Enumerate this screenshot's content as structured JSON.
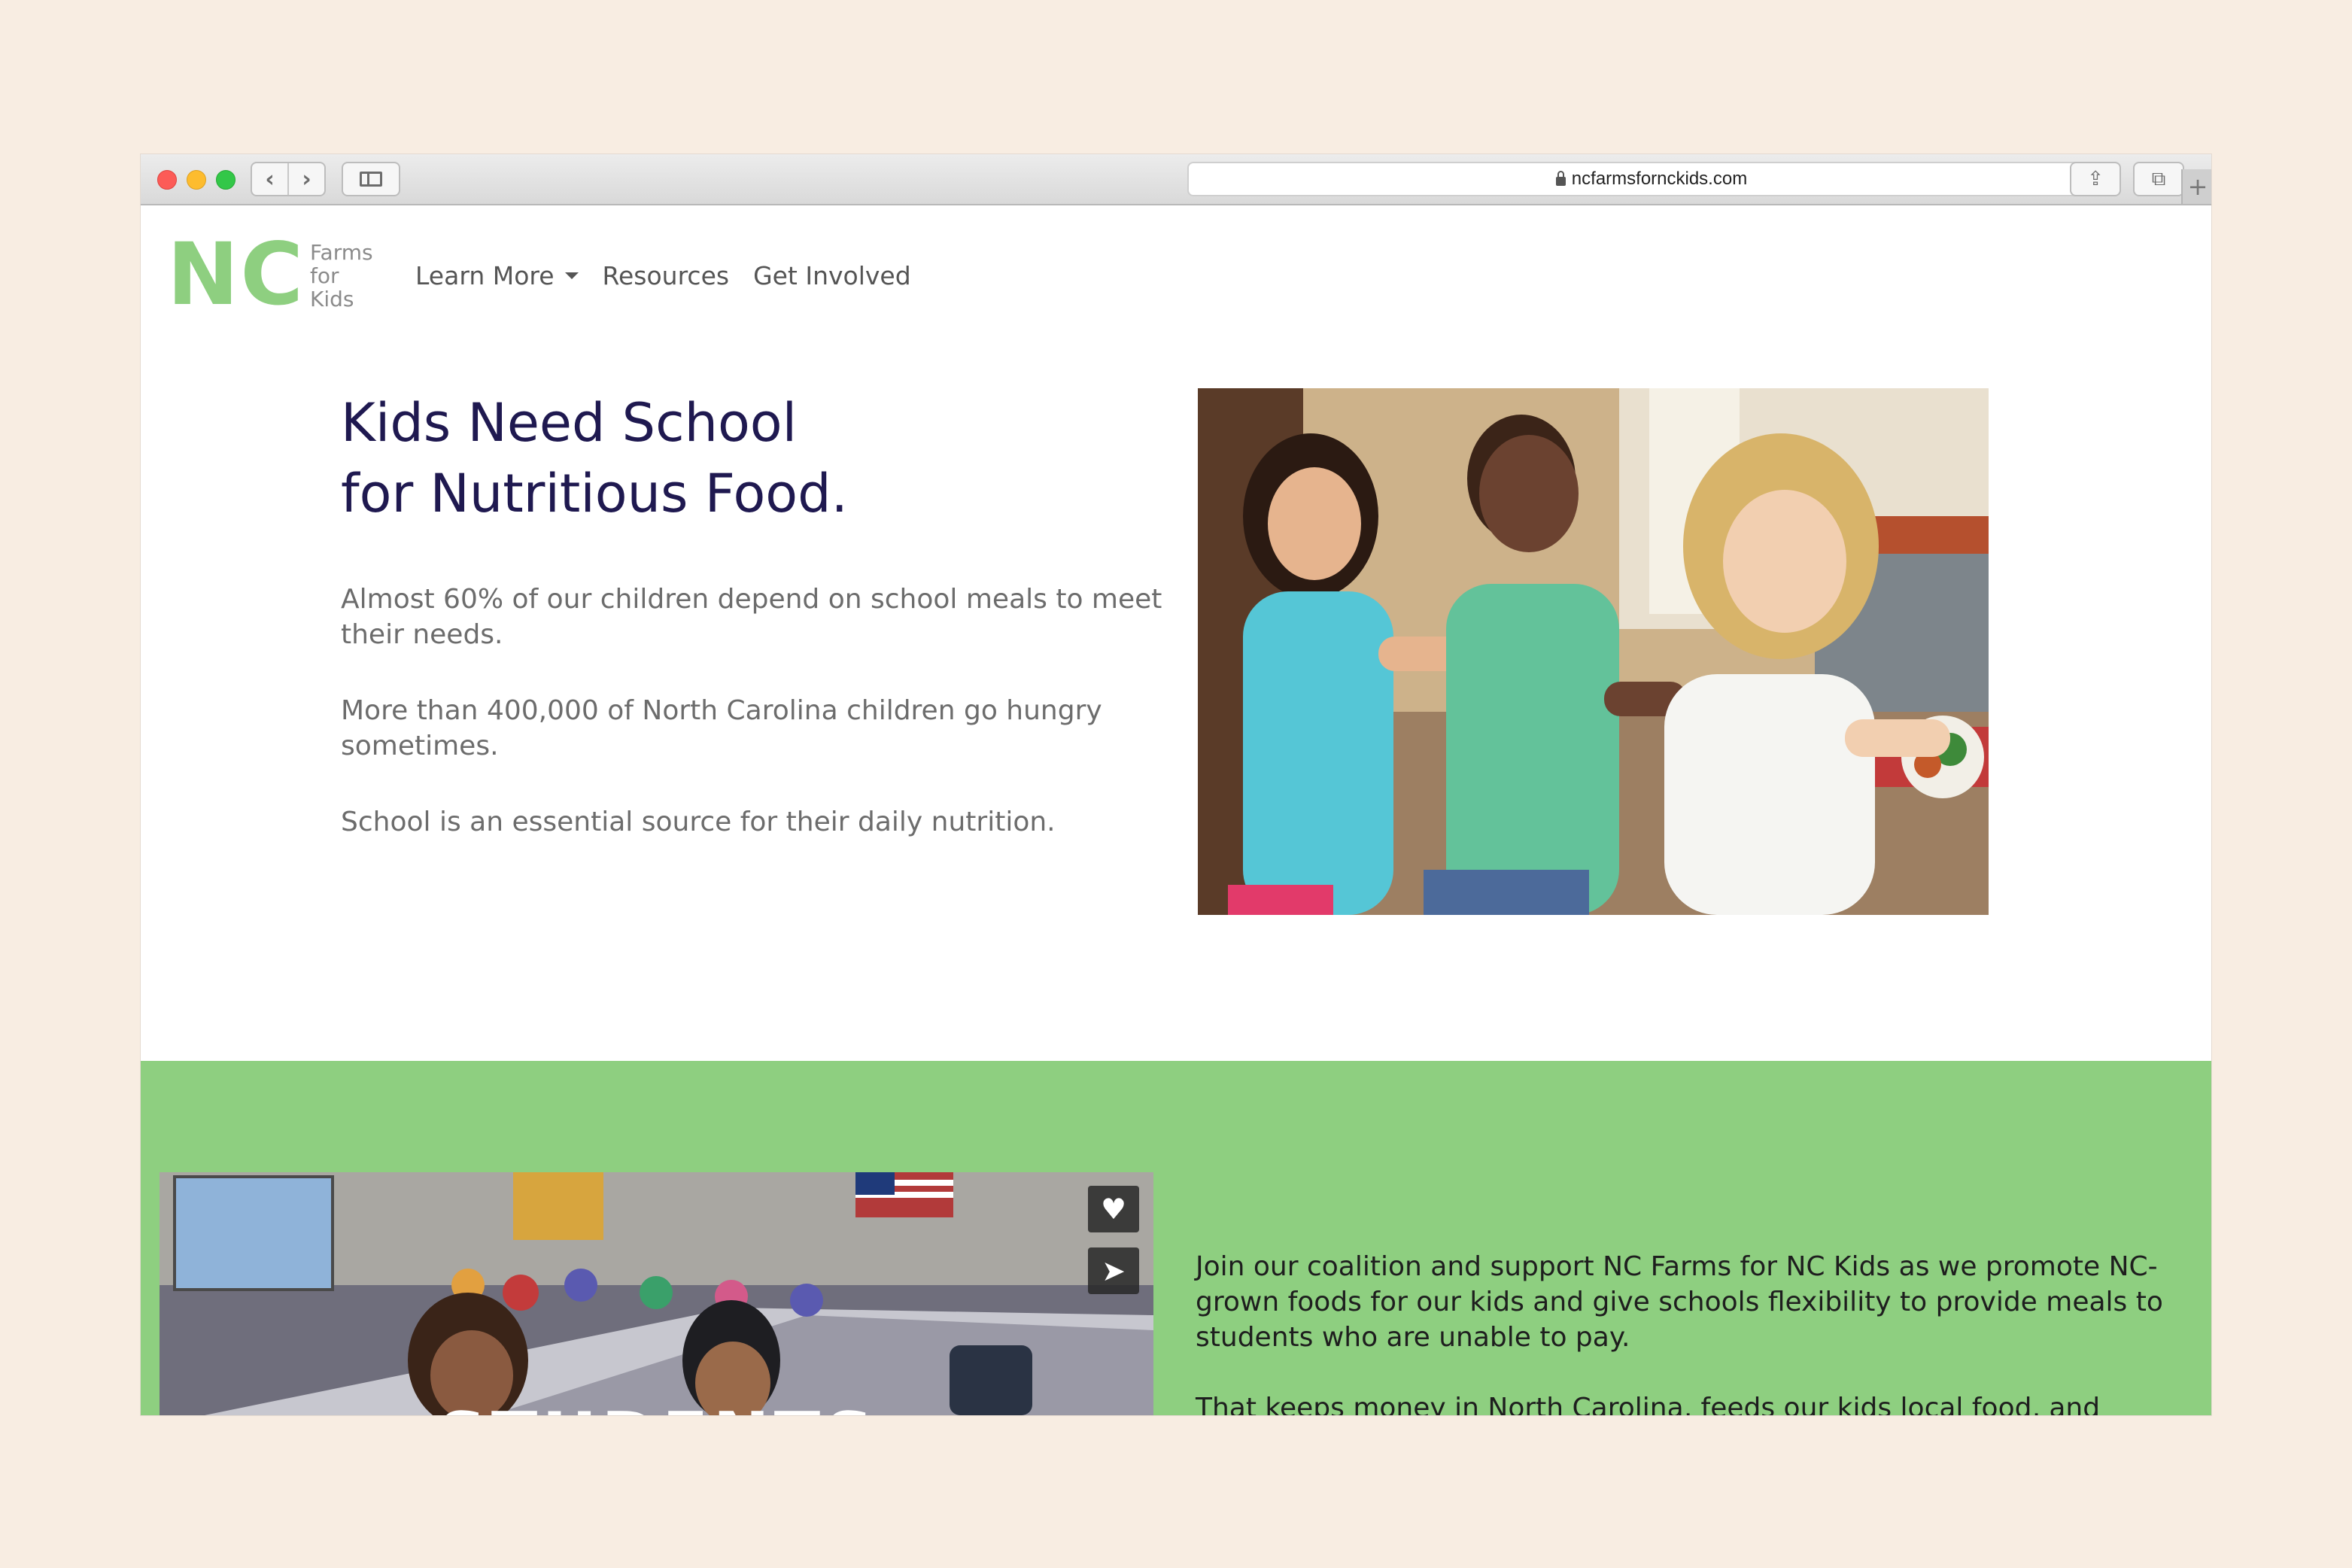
{
  "browser": {
    "url": "ncfarmsfornckids.com",
    "back_glyph": "‹",
    "forward_glyph": "›",
    "reload_glyph": "↻",
    "share_glyph": "⇪",
    "tabs_glyph": "⧉",
    "new_tab_glyph": "+"
  },
  "logo": {
    "main": "NC",
    "line1": "Farms",
    "line2": "for",
    "line3": "Kids",
    "color": "#8ecf80"
  },
  "nav": {
    "items": [
      {
        "label": "Learn More",
        "has_dropdown": true
      },
      {
        "label": "Resources"
      },
      {
        "label": "Get Involved"
      }
    ]
  },
  "hero": {
    "title_line1": "Kids Need School",
    "title_line2": "for Nutritious Food.",
    "paragraphs": [
      "Almost 60% of our children depend on school meals to meet their needs.",
      "More than 400,000 of North Carolina children go hungry sometimes.",
      "School is an essential source for their daily nutrition."
    ],
    "title_color": "#1f1950"
  },
  "coalition": {
    "background": "#8ecf80",
    "video_overlay_text": "STUDENTS",
    "like_icon": "heart-icon",
    "share_icon": "paper-plane-icon",
    "paragraphs": [
      "Join our coalition and support NC Farms for NC Kids as we promote NC-grown foods for our kids and give schools flexibility to provide meals to students who are unable to pay.",
      "That keeps money in North Carolina, feeds our kids local food, and"
    ]
  }
}
